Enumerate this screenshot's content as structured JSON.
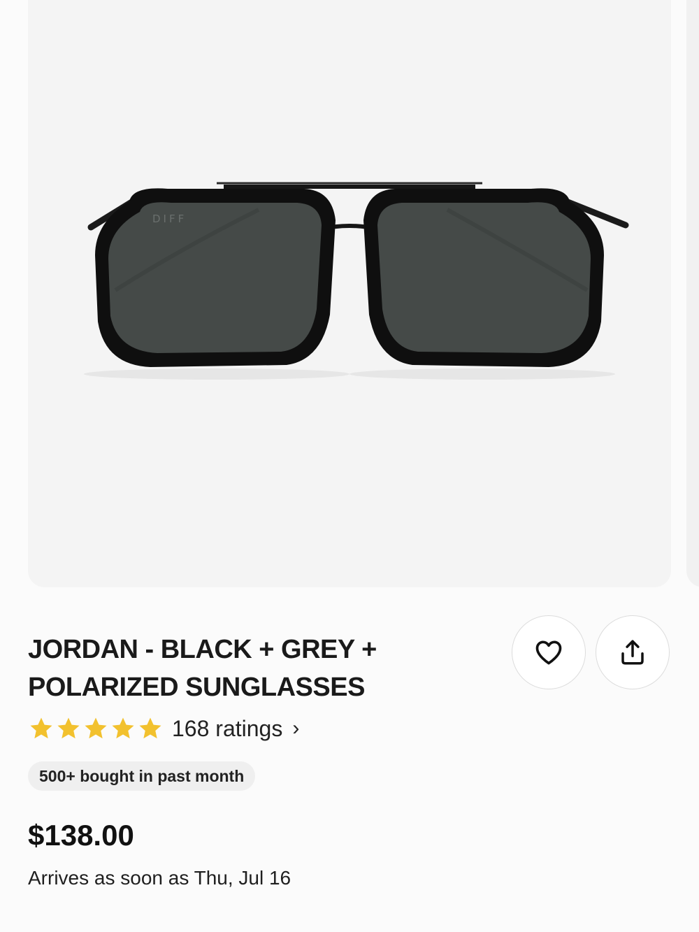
{
  "product": {
    "title": "JORDAN - BLACK + GREY + POLARIZED SUNGLASSES",
    "ratings_count_label": "168 ratings",
    "rating_stars": 5,
    "star_color": "#f2c12e",
    "badge": "500+ bought in past month",
    "price": "$138.00",
    "delivery": "Arrives as soon as Thu, Jul 16",
    "image_brand_mark": "DIFF"
  },
  "actions": {
    "favorite_icon": "heart-icon",
    "share_icon": "share-icon"
  },
  "chevron": "›"
}
